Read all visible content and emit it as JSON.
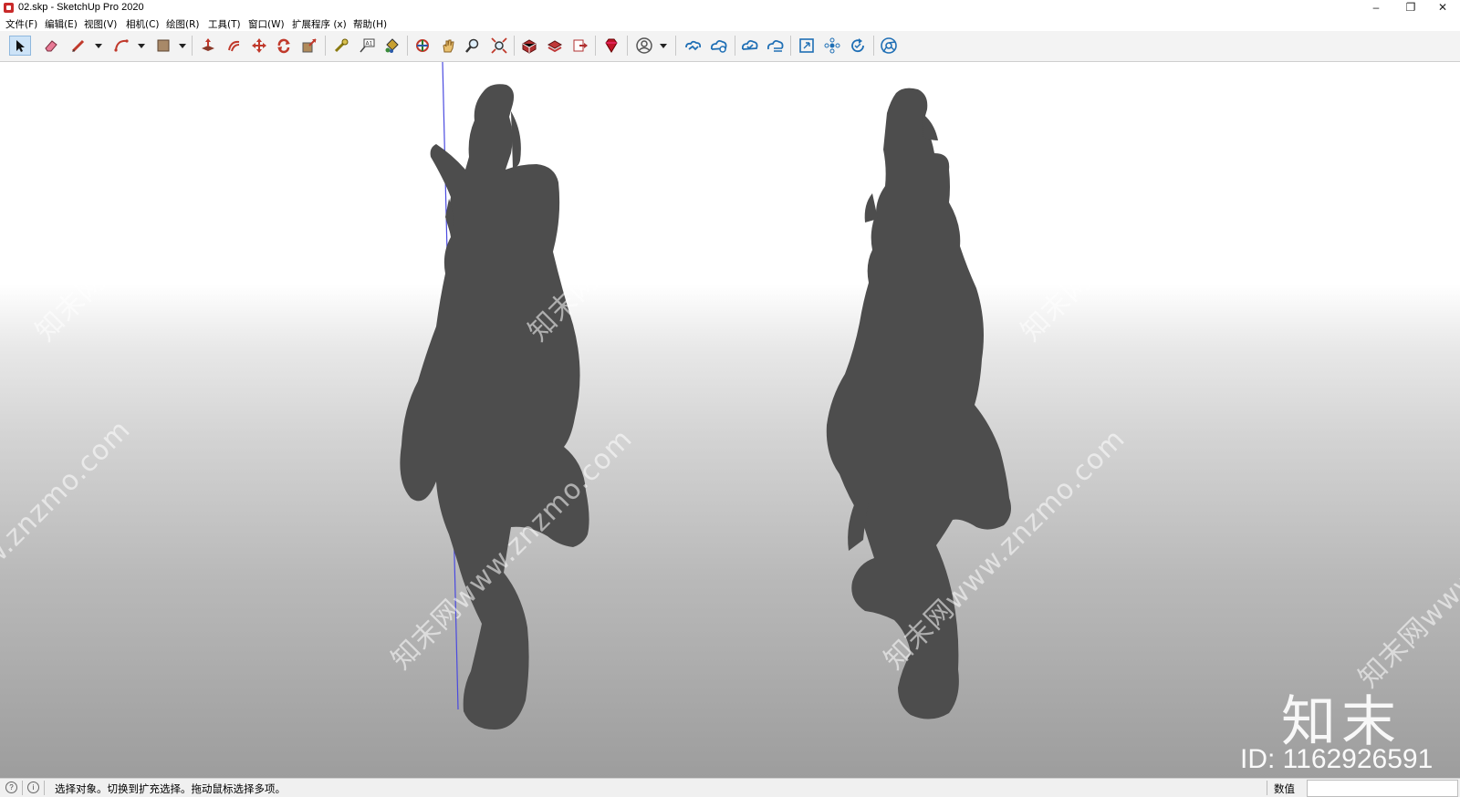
{
  "window": {
    "title": "02.skp - SketchUp Pro 2020",
    "controls": {
      "minimize": "–",
      "restore": "❐",
      "close": "✕"
    }
  },
  "menu": [
    "文件(F)",
    "编辑(E)",
    "视图(V)",
    "相机(C)",
    "绘图(R)",
    "工具(T)",
    "窗口(W)",
    "扩展程序 (x)",
    "帮助(H)"
  ],
  "toolbar": {
    "tools": [
      {
        "icon": "select-arrow-icon",
        "color": "#1a1a1a"
      },
      {
        "icon": "eraser-icon",
        "color": "#e05a7a"
      },
      {
        "icon": "pencil-line-icon",
        "color": "#c0392b"
      },
      {
        "icon": "arc-icon",
        "color": "#c0392b"
      },
      {
        "icon": "rectangle-icon",
        "color": "#8b6e52"
      },
      {
        "icon": "push-pull-icon",
        "color": "#b03020"
      },
      {
        "icon": "offset-icon",
        "color": "#c0392b"
      },
      {
        "icon": "move-icon",
        "color": "#c0392b"
      },
      {
        "icon": "rotate-icon",
        "color": "#c0392b"
      },
      {
        "icon": "scale-icon",
        "color": "#c0392b"
      },
      {
        "icon": "tape-measure-icon",
        "color": "#8a7a10"
      },
      {
        "icon": "text-label-icon",
        "color": "#555555"
      },
      {
        "icon": "paint-bucket-icon",
        "color": "#b08a20"
      },
      {
        "icon": "orbit-icon",
        "color": "#2a7a2a"
      },
      {
        "icon": "pan-hand-icon",
        "color": "#d4a84a"
      },
      {
        "icon": "zoom-icon",
        "color": "#333333"
      },
      {
        "icon": "zoom-extents-icon",
        "color": "#333333"
      },
      {
        "icon": "3d-warehouse-icon",
        "color": "#b03030"
      },
      {
        "icon": "extension-warehouse-icon",
        "color": "#b03030"
      },
      {
        "icon": "send-to-layout-icon",
        "color": "#b03030"
      },
      {
        "icon": "ruby-console-icon",
        "color": "#b01020"
      },
      {
        "icon": "account-icon",
        "color": "#444444"
      },
      {
        "icon": "trimble-connect-icon",
        "color": "#1f6fb5"
      },
      {
        "icon": "cloud-share-icon",
        "color": "#1f6fb5"
      },
      {
        "icon": "cloud-sync-icon",
        "color": "#1f6fb5"
      },
      {
        "icon": "cloud-list-icon",
        "color": "#1f6fb5"
      },
      {
        "icon": "section-view-icon",
        "color": "#1f6fb5"
      },
      {
        "icon": "components-icon",
        "color": "#1f6fb5"
      },
      {
        "icon": "update-icon",
        "color": "#1f6fb5"
      },
      {
        "icon": "chrome-browser-icon",
        "color": "#1f6fb5"
      }
    ]
  },
  "viewport": {
    "watermark": "知末网www.znzmo.com",
    "brand_logo": "知末",
    "brand_id": "ID: 1162926591",
    "figure_color": "#4d4d4d",
    "axis_color": "#4a4ae0"
  },
  "status": {
    "message": "选择对象。切换到扩充选择。拖动鼠标选择多项。",
    "measurements_label": "数值",
    "measurements_value": ""
  }
}
